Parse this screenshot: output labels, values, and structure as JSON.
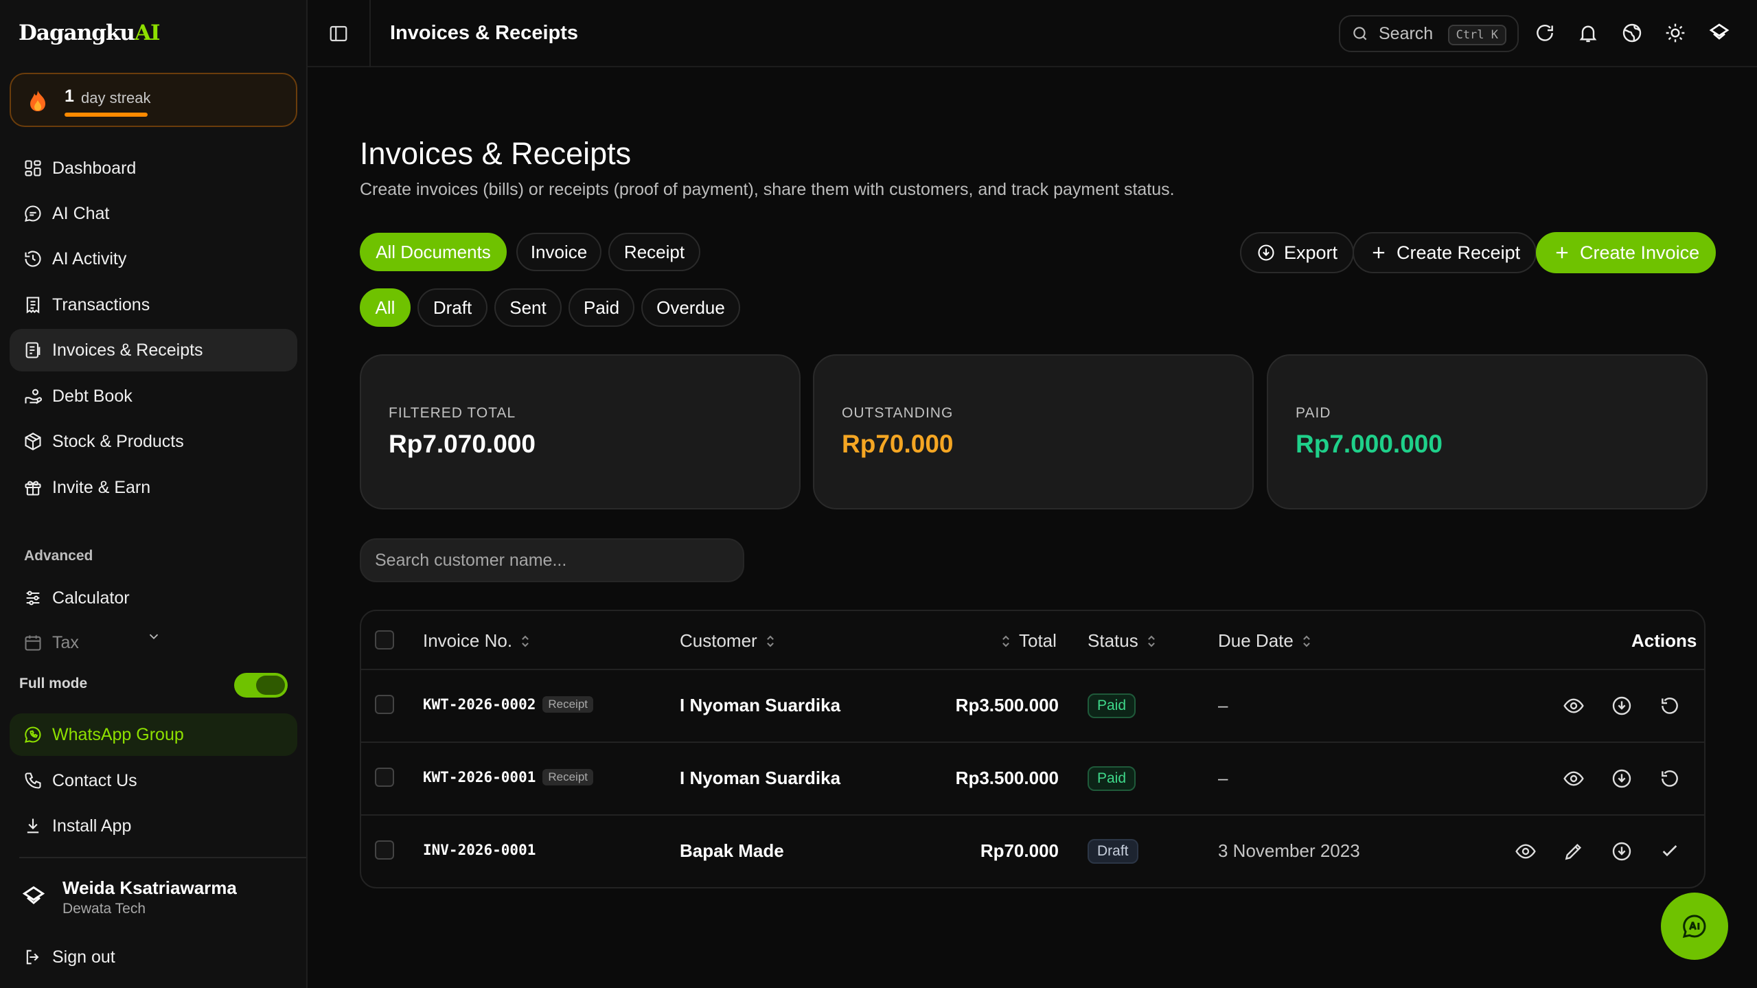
{
  "sidebar": {
    "brand": {
      "main": "Dagangku",
      "accent": "AI"
    },
    "streak": {
      "count": "1",
      "label": "day streak",
      "progress": 0.55
    },
    "nav": [
      {
        "label": "Dashboard",
        "icon": "dashboard-icon"
      },
      {
        "label": "AI Chat",
        "icon": "chat-icon"
      },
      {
        "label": "AI Activity",
        "icon": "history-icon"
      },
      {
        "label": "Transactions",
        "icon": "receipt-icon"
      },
      {
        "label": "Invoices & Receipts",
        "icon": "invoice-icon",
        "active": true
      },
      {
        "label": "Debt Book",
        "icon": "hand-coins-icon"
      },
      {
        "label": "Stock & Products",
        "icon": "package-icon"
      },
      {
        "label": "Invite & Earn",
        "icon": "gift-icon"
      }
    ],
    "advanced_label": "Advanced",
    "advanced": [
      {
        "label": "Calculator",
        "icon": "sliders-icon"
      },
      {
        "label": "Tax",
        "icon": "calendar-icon"
      }
    ],
    "full_mode_label": "Full mode",
    "full_mode_on": true,
    "links": [
      {
        "label": "WhatsApp Group",
        "icon": "whatsapp-icon"
      },
      {
        "label": "Contact Us",
        "icon": "phone-icon"
      },
      {
        "label": "Install App",
        "icon": "download-icon"
      }
    ],
    "user": {
      "name": "Weida Ksatriawarma",
      "org": "Dewata Tech"
    },
    "sign_out": "Sign out"
  },
  "topbar": {
    "title": "Invoices & Receipts",
    "search_label": "Search",
    "shortcut": "Ctrl K"
  },
  "main": {
    "title": "Invoices & Receipts",
    "subtitle": "Create invoices (bills) or receipts (proof of payment), share them with customers, and track payment status.",
    "doc_tabs": [
      "All Documents",
      "Invoice",
      "Receipt"
    ],
    "status_tabs": [
      "All",
      "Draft",
      "Sent",
      "Paid",
      "Overdue"
    ],
    "export_label": "Export",
    "create_receipt_label": "Create Receipt",
    "create_invoice_label": "Create Invoice",
    "stats": [
      {
        "label": "FILTERED TOTAL",
        "value": "Rp7.070.000",
        "color": "#ffffff"
      },
      {
        "label": "OUTSTANDING",
        "value": "Rp70.000",
        "color": "#f5a623"
      },
      {
        "label": "PAID",
        "value": "Rp7.000.000",
        "color": "#1fd08a"
      }
    ],
    "search_placeholder": "Search customer name...",
    "table": {
      "headers": {
        "invoice_no": "Invoice No.",
        "customer": "Customer",
        "total": "Total",
        "status": "Status",
        "due_date": "Due Date",
        "actions": "Actions"
      },
      "rows": [
        {
          "no": "KWT-2026-0002",
          "tag": "Receipt",
          "customer": "I Nyoman Suardika",
          "total": "Rp3.500.000",
          "status": "Paid",
          "due": "–"
        },
        {
          "no": "KWT-2026-0001",
          "tag": "Receipt",
          "customer": "I Nyoman Suardika",
          "total": "Rp3.500.000",
          "status": "Paid",
          "due": "–"
        },
        {
          "no": "INV-2026-0001",
          "tag": "",
          "customer": "Bapak Made",
          "total": "Rp70.000",
          "status": "Draft",
          "due": "3 November 2023"
        }
      ]
    }
  },
  "colors": {
    "accent": "#6fc200",
    "outstanding": "#f5a623",
    "paid": "#1fd08a"
  }
}
